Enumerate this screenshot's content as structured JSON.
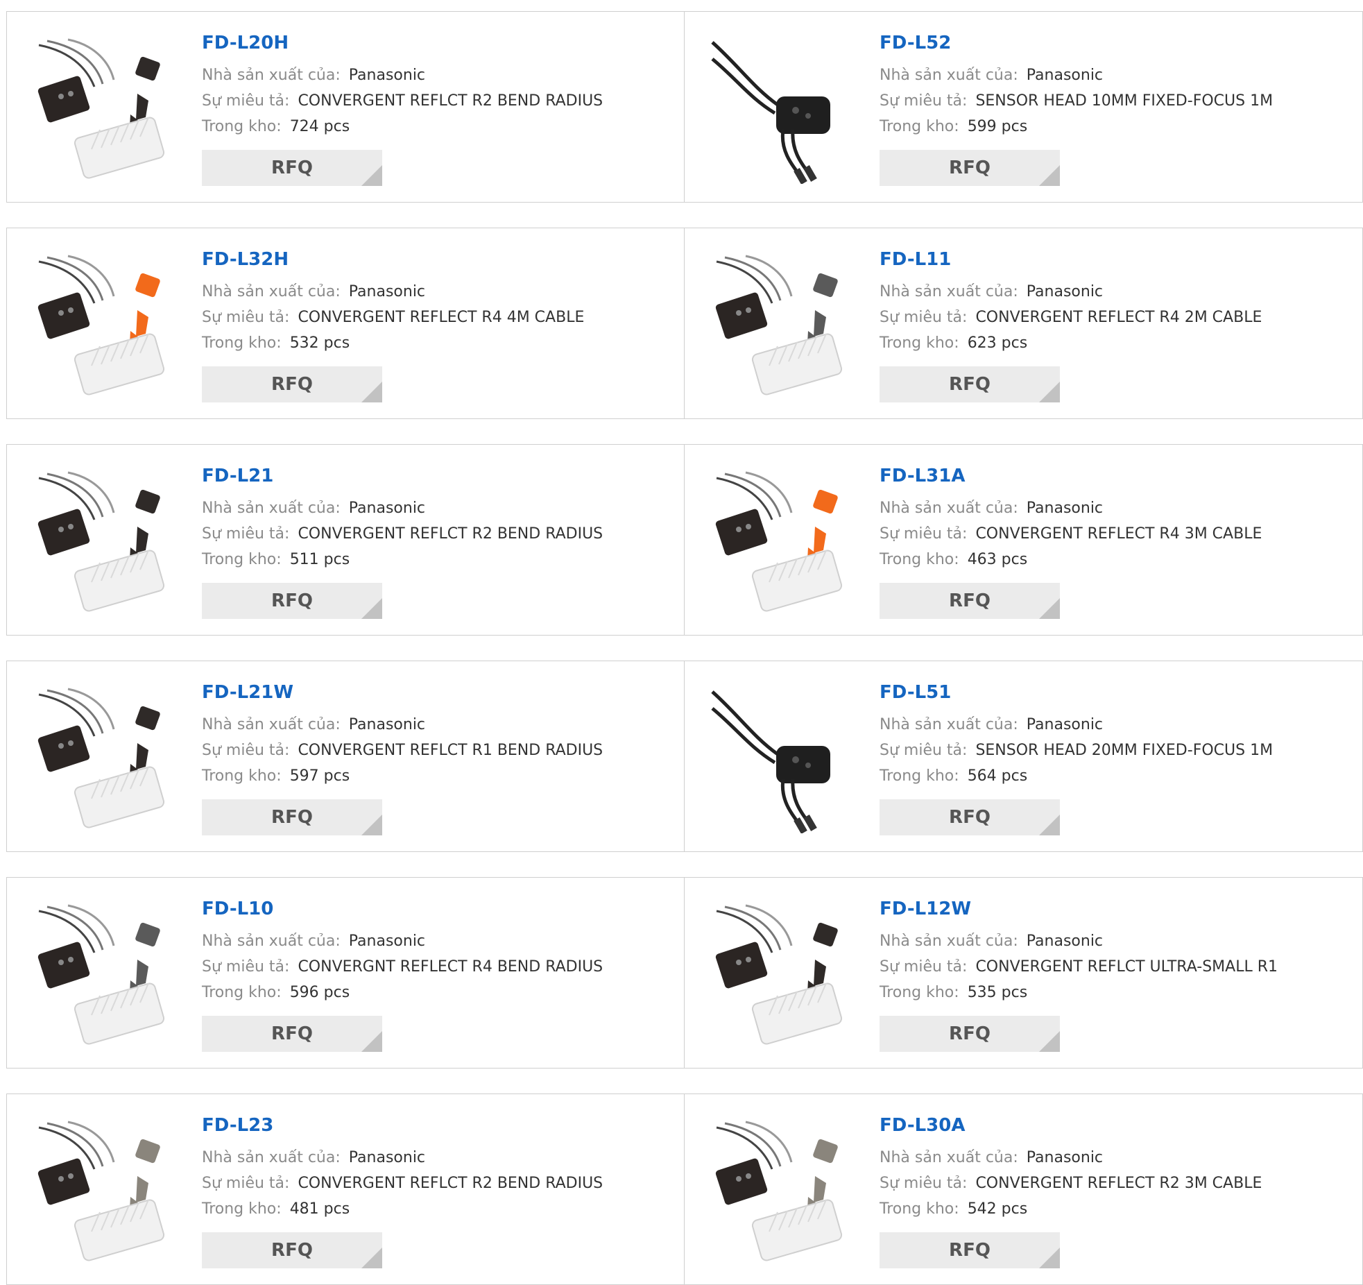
{
  "labels": {
    "manufacturer": "Nhà sản xuất của:",
    "description": "Sự miêu tả:",
    "stock": "Trong kho:",
    "rfq": "RFQ"
  },
  "products": [
    {
      "part": "FD-L20H",
      "manufacturer": "Panasonic",
      "description": "CONVERGENT REFLCT R2 BEND RADIUS",
      "stock": "724 pcs",
      "image": "sensor-kit-black"
    },
    {
      "part": "FD-L52",
      "manufacturer": "Panasonic",
      "description": "SENSOR HEAD 10MM FIXED-FOCUS 1M",
      "stock": "599 pcs",
      "image": "sensor-head-cable"
    },
    {
      "part": "FD-L32H",
      "manufacturer": "Panasonic",
      "description": "CONVERGENT REFLECT R4 4M CABLE",
      "stock": "532 pcs",
      "image": "sensor-kit-orange"
    },
    {
      "part": "FD-L11",
      "manufacturer": "Panasonic",
      "description": "CONVERGENT REFLECT R4 2M CABLE",
      "stock": "623 pcs",
      "image": "sensor-kit-grey"
    },
    {
      "part": "FD-L21",
      "manufacturer": "Panasonic",
      "description": "CONVERGENT REFLCT R2 BEND RADIUS",
      "stock": "511 pcs",
      "image": "sensor-kit-black"
    },
    {
      "part": "FD-L31A",
      "manufacturer": "Panasonic",
      "description": "CONVERGENT REFLECT R4 3M CABLE",
      "stock": "463 pcs",
      "image": "sensor-kit-orange"
    },
    {
      "part": "FD-L21W",
      "manufacturer": "Panasonic",
      "description": "CONVERGENT REFLCT R1 BEND RADIUS",
      "stock": "597 pcs",
      "image": "sensor-kit-black"
    },
    {
      "part": "FD-L51",
      "manufacturer": "Panasonic",
      "description": "SENSOR HEAD 20MM FIXED-FOCUS 1M",
      "stock": "564 pcs",
      "image": "sensor-head-cable"
    },
    {
      "part": "FD-L10",
      "manufacturer": "Panasonic",
      "description": "CONVERGNT REFLECT R4 BEND RADIUS",
      "stock": "596 pcs",
      "image": "sensor-kit-grey"
    },
    {
      "part": "FD-L12W",
      "manufacturer": "Panasonic",
      "description": "CONVERGENT REFLCT ULTRA-SMALL R1",
      "stock": "535 pcs",
      "image": "sensor-kit-black"
    },
    {
      "part": "FD-L23",
      "manufacturer": "Panasonic",
      "description": "CONVERGENT REFLCT R2 BEND RADIUS",
      "stock": "481 pcs",
      "image": "sensor-kit-taupe"
    },
    {
      "part": "FD-L30A",
      "manufacturer": "Panasonic",
      "description": "CONVERGENT REFLECT R2 3M CABLE",
      "stock": "542 pcs",
      "image": "sensor-kit-taupe"
    }
  ],
  "colors": {
    "part_link": "#1565c0",
    "label": "#8a8a8a",
    "value": "#333333",
    "rfq_bg": "#ebebeb",
    "rfq_text": "#555555",
    "border": "#cfcfcf"
  }
}
